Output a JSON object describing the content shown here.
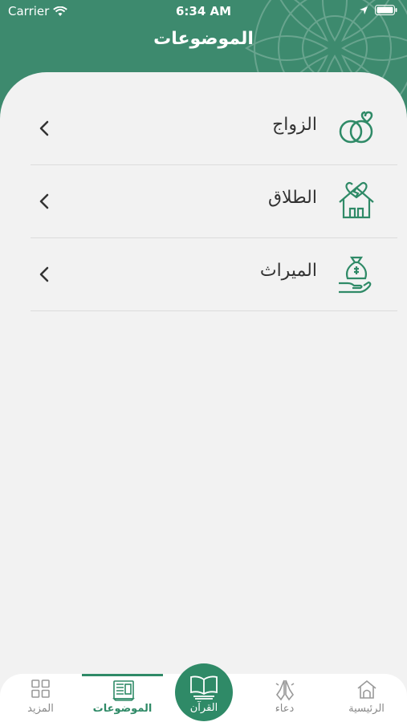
{
  "status_bar": {
    "carrier": "Carrier",
    "time": "6:34 AM"
  },
  "header": {
    "title": "الموضوعات"
  },
  "topics": [
    {
      "label": "الزواج",
      "icon": "rings-icon"
    },
    {
      "label": "الطلاق",
      "icon": "broken-heart-house-icon"
    },
    {
      "label": "الميراث",
      "icon": "money-bag-hand-icon"
    }
  ],
  "tabbar": {
    "home": "الرئيسية",
    "dua": "دعاء",
    "quran": "القرآن",
    "topics": "الموضوعات",
    "more": "المزيد",
    "active": "topics"
  },
  "colors": {
    "primary": "#2f8a67",
    "header": "#3d8a6e",
    "background": "#f2f2f2"
  }
}
